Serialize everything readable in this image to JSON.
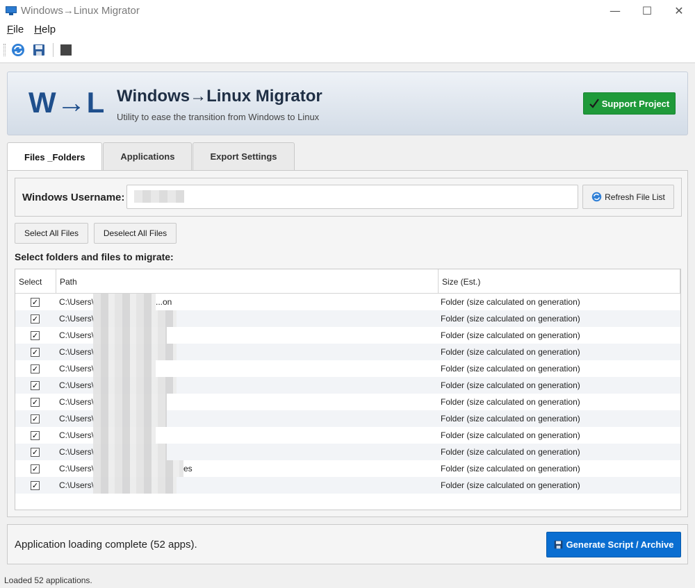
{
  "window": {
    "title": "Windows→Linux Migrator",
    "minimize_glyph": "—",
    "maximize_glyph": "☐",
    "close_glyph": "✕"
  },
  "menu": {
    "file": {
      "accel": "F",
      "rest": "ile"
    },
    "help": {
      "accel": "H",
      "rest": "elp"
    }
  },
  "toolbar": {
    "icons": [
      "refresh-icon",
      "save-icon",
      "stop-icon"
    ]
  },
  "header": {
    "logo": "W→L",
    "title": "Windows→Linux Migrator",
    "subtitle": "Utility to ease the transition from Windows to Linux",
    "support_button": "Support Project",
    "support_icon": "checkmark-icon",
    "support_color": "#1f9a3a"
  },
  "tabs": [
    {
      "label": "Files _Folders",
      "active": true
    },
    {
      "label": "Applications",
      "active": false
    },
    {
      "label": "Export Settings",
      "active": false
    }
  ],
  "files_tab": {
    "username_label": "Windows Username:",
    "username_value": "",
    "refresh_button": "Refresh File List",
    "select_all_button": "Select All Files",
    "deselect_all_button": "Deselect All Files",
    "section_label": "Select folders and files to migrate:",
    "columns": [
      "Select",
      "Path",
      "Size (Est.)"
    ],
    "rows": [
      {
        "checked": true,
        "path_prefix": "C:\\Users\\",
        "path_suffix": "...on",
        "size": "Folder (size calculated on generation)"
      },
      {
        "checked": true,
        "path_prefix": "C:\\Users\\",
        "path_suffix": "",
        "size": "Folder (size calculated on generation)"
      },
      {
        "checked": true,
        "path_prefix": "C:\\Users\\",
        "path_suffix": "",
        "size": "Folder (size calculated on generation)"
      },
      {
        "checked": true,
        "path_prefix": "C:\\Users\\",
        "path_suffix": "",
        "size": "Folder (size calculated on generation)"
      },
      {
        "checked": true,
        "path_prefix": "C:\\Users\\",
        "path_suffix": "",
        "size": "Folder (size calculated on generation)"
      },
      {
        "checked": true,
        "path_prefix": "C:\\Users\\",
        "path_suffix": "",
        "size": "Folder (size calculated on generation)"
      },
      {
        "checked": true,
        "path_prefix": "C:\\Users\\",
        "path_suffix": "",
        "size": "Folder (size calculated on generation)"
      },
      {
        "checked": true,
        "path_prefix": "C:\\Users\\",
        "path_suffix": "",
        "size": "Folder (size calculated on generation)"
      },
      {
        "checked": true,
        "path_prefix": "C:\\Users\\",
        "path_suffix": "",
        "size": "Folder (size calculated on generation)"
      },
      {
        "checked": true,
        "path_prefix": "C:\\Users\\",
        "path_suffix": "",
        "size": "Folder (size calculated on generation)"
      },
      {
        "checked": true,
        "path_prefix": "C:\\Users\\",
        "path_suffix": "es",
        "size": "Folder (size calculated on generation)"
      },
      {
        "checked": true,
        "path_prefix": "C:\\Users\\",
        "path_suffix": "",
        "size": "Folder (size calculated on generation)"
      }
    ]
  },
  "footer": {
    "status_message": "Application loading complete (52 apps).",
    "generate_button": "Generate Script / Archive",
    "generate_color": "#0a6ed1",
    "statusbar_text": "Loaded 52 applications."
  }
}
